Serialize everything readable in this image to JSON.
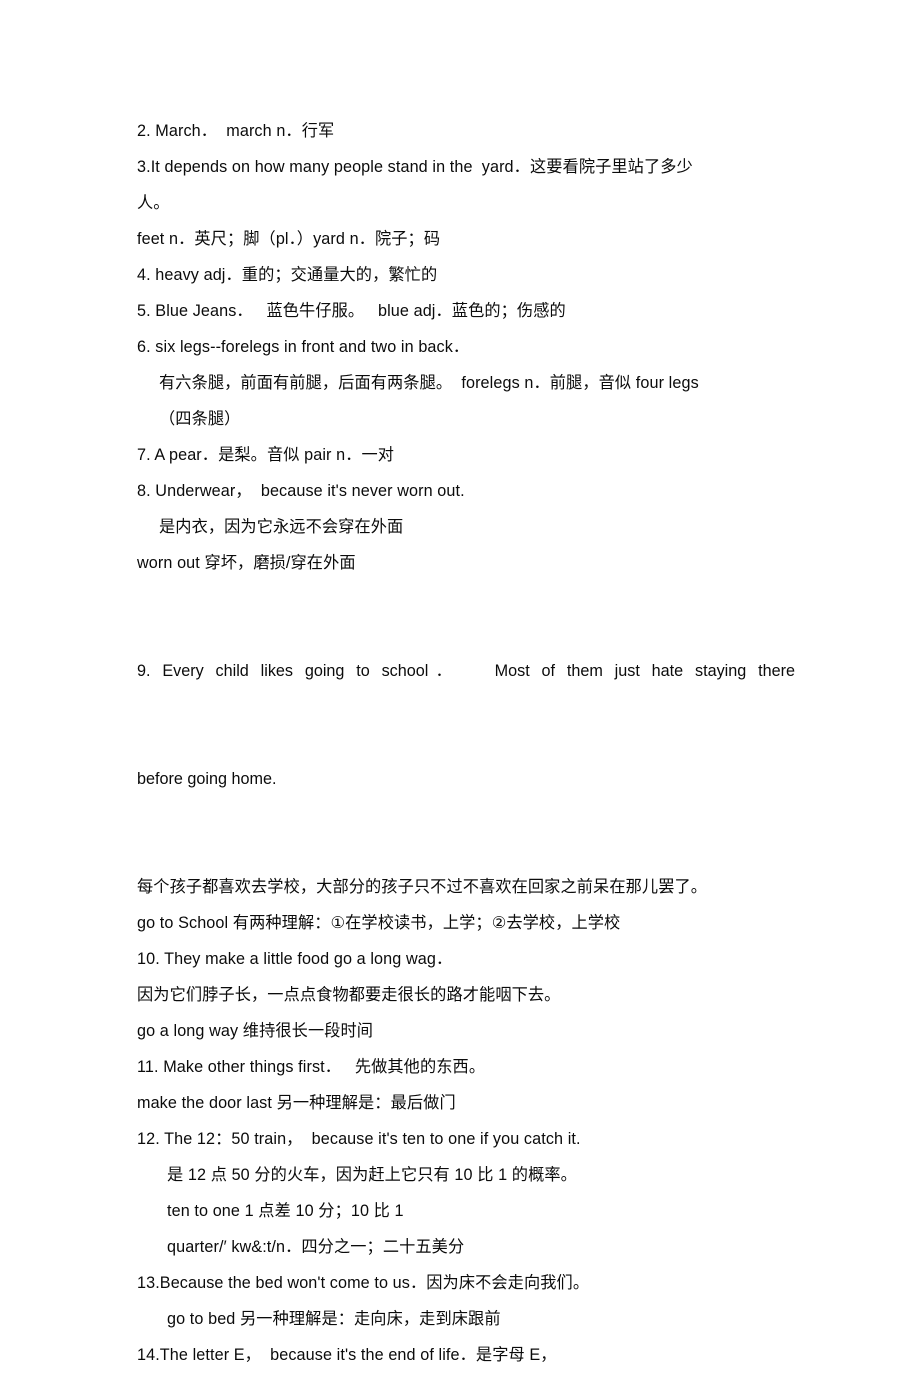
{
  "document": {
    "kind": "scanned-study-notes",
    "background_color": "#ffffff",
    "text_color": "#0b0b0b",
    "lines": [
      {
        "id": "item-2",
        "indent": 0,
        "text": "2. March．  march n．行军"
      },
      {
        "id": "item-3",
        "indent": 0,
        "text": "3.It depends on how many people stand in the  yard．这要看院子里站了多少"
      },
      {
        "id": "item-3-cont",
        "indent": 0,
        "text": "人。"
      },
      {
        "id": "note-feet",
        "indent": 0,
        "text": "feet n．英尺；脚（pl．）yard n．院子；码"
      },
      {
        "id": "item-4",
        "indent": 0,
        "text": "4. heavy adj．重的；交通量大的，繁忙的"
      },
      {
        "id": "item-5",
        "indent": 0,
        "text": "5. Blue Jeans．   蓝色牛仔服。   blue adj．蓝色的；伤感的"
      },
      {
        "id": "item-6",
        "indent": 0,
        "text": "6. six legs--forelegs in front and two in back．"
      },
      {
        "id": "item-6-cn",
        "indent": 1,
        "text": "有六条腿，前面有前腿，后面有两条腿。  forelegs n．前腿，音似 four legs"
      },
      {
        "id": "item-6-cn2",
        "indent": 1,
        "text": "（四条腿）"
      },
      {
        "id": "item-7",
        "indent": 0,
        "text": "7. A pear．是梨。音似 pair n．一对"
      },
      {
        "id": "item-8",
        "indent": 0,
        "text": "8. Underwear，  because it's never worn out."
      },
      {
        "id": "item-8-cn",
        "indent": 1,
        "text": "是内衣，因为它永远不会穿在外面"
      },
      {
        "id": "note-worn-out",
        "indent": 0,
        "text": "worn out 穿坏，磨损/穿在外面"
      },
      {
        "id": "item-9-cn",
        "indent": 0,
        "text": "每个孩子都喜欢去学校，大部分的孩子只不过不喜欢在回家之前呆在那儿罢了。"
      },
      {
        "id": "note-go-to-school",
        "indent": 0,
        "text": "go to School 有两种理解：①在学校读书，上学；②去学校，上学校"
      },
      {
        "id": "item-10",
        "indent": 0,
        "text": "10. They make a little food go a long wag．"
      },
      {
        "id": "item-10-cn",
        "indent": 0,
        "text": "因为它们脖子长，一点点食物都要走很长的路才能咽下去。"
      },
      {
        "id": "note-go-a-long-way",
        "indent": 0,
        "text": "go a long way 维持很长一段时间"
      },
      {
        "id": "item-11",
        "indent": 0,
        "text": "11. Make other things first．   先做其他的东西。"
      },
      {
        "id": "note-make-door-last",
        "indent": 0,
        "text": "make the door last 另一种理解是：最后做门"
      },
      {
        "id": "item-12",
        "indent": 0,
        "text": "12. The 12：50 train，  because it's ten to one if you catch it."
      },
      {
        "id": "item-12-cn",
        "indent": 2,
        "text": "是 12 点 50 分的火车，因为赶上它只有 10 比 1 的概率。"
      },
      {
        "id": "note-ten-to-one",
        "indent": 2,
        "text": "ten to one 1 点差 10 分；10 比 1"
      },
      {
        "id": "note-quarter",
        "indent": 2,
        "text": "quarter/′ kw&:t/n．四分之一；二十五美分"
      },
      {
        "id": "item-13",
        "indent": 0,
        "text": "13.Because the bed won't come to us．因为床不会走向我们。"
      },
      {
        "id": "note-go-to-bed",
        "indent": 2,
        "text": "go to bed 另一种理解是：走向床，走到床跟前"
      },
      {
        "id": "item-14",
        "indent": 0,
        "text": "14.The letter E，  because it's the end of life．是字母 E，"
      }
    ],
    "justified_block": {
      "id": "item-9",
      "line_1": "9. Every child likes going to school．   Most of them just hate staying there",
      "line_2": "before going home."
    }
  }
}
